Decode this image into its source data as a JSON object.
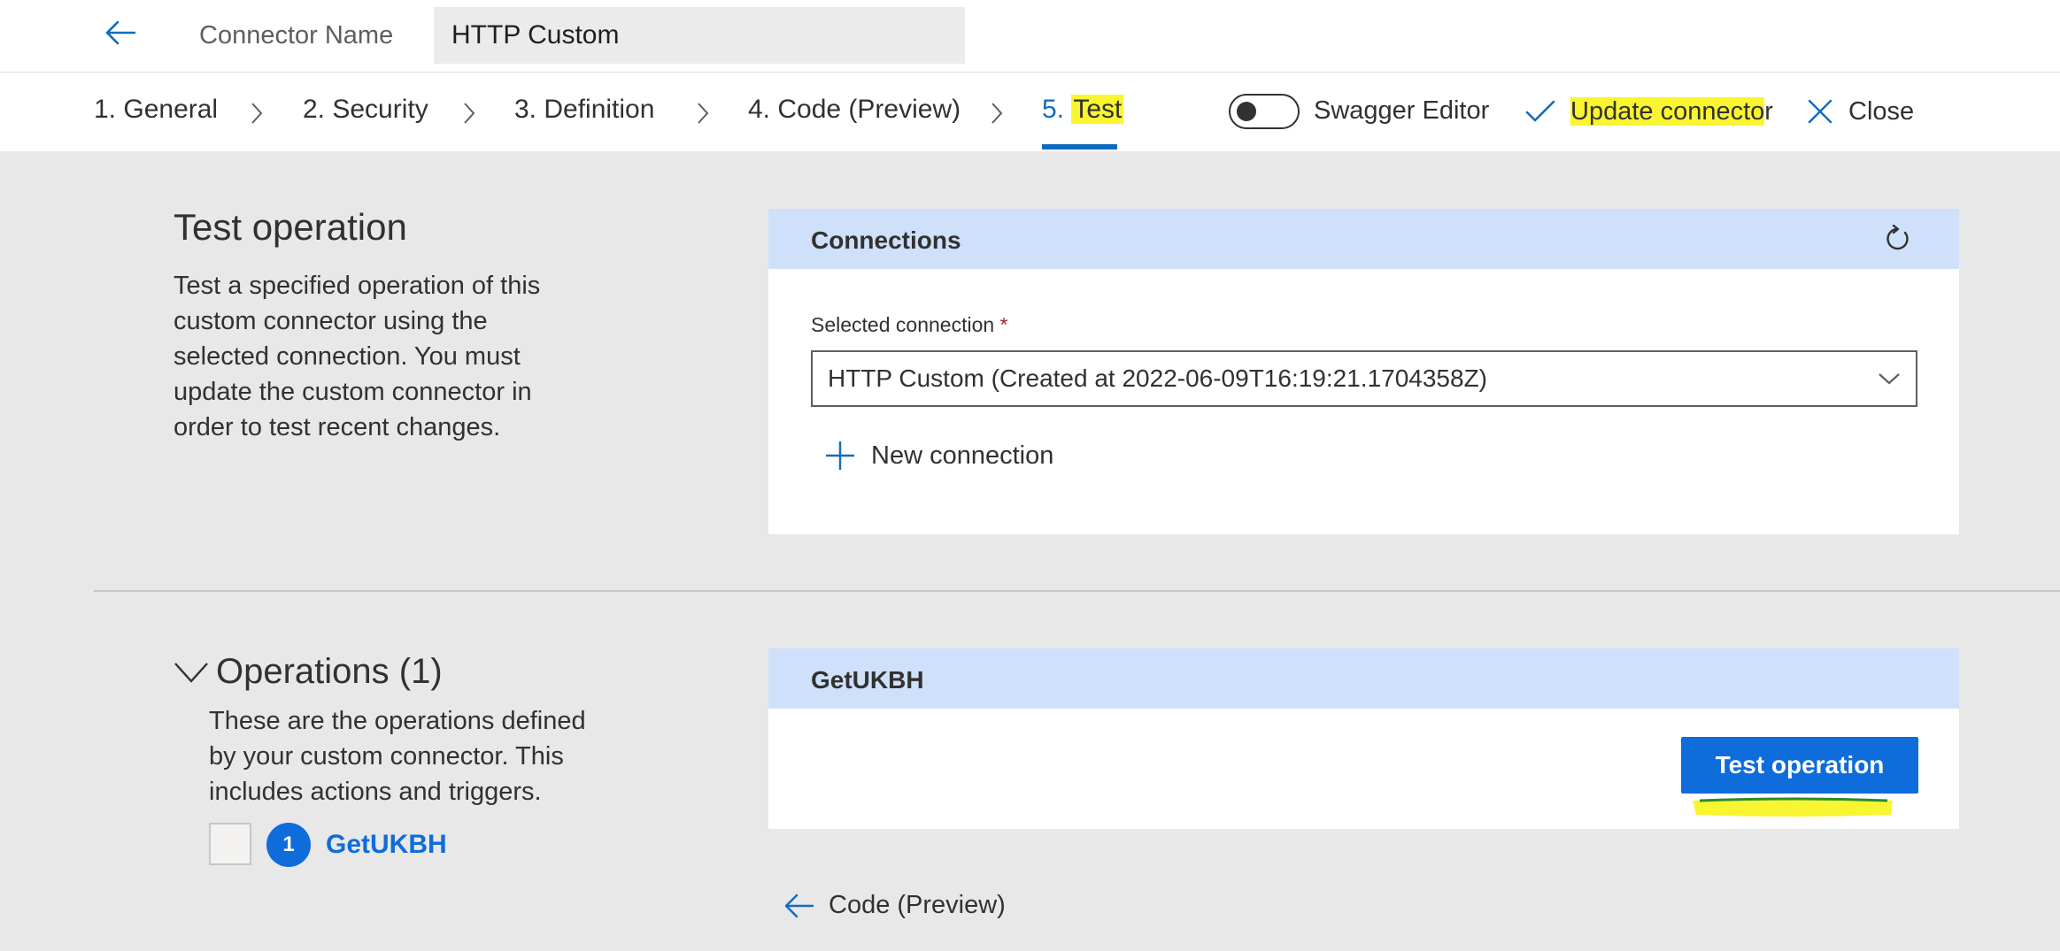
{
  "header": {
    "connector_label": "Connector Name",
    "connector_value": "HTTP Custom"
  },
  "nav": {
    "steps": [
      {
        "prefix": "1. ",
        "label": "General"
      },
      {
        "prefix": "2. ",
        "label": "Security"
      },
      {
        "prefix": "3. ",
        "label": "Definition"
      },
      {
        "prefix": "4. ",
        "label": "Code (Preview)"
      },
      {
        "prefix": "5. ",
        "label": "Test"
      }
    ],
    "active_step": "5",
    "swagger_label": "Swagger Editor",
    "swagger_on": false,
    "update_label_highlighted": "Update connecto",
    "update_label_rest": "r",
    "close_label": "Close"
  },
  "test_section": {
    "title": "Test operation",
    "description_lines": [
      "Test a specified operation of this",
      "custom connector using the",
      "selected connection. You must",
      "update the custom connector in",
      "order to test recent changes."
    ]
  },
  "connections_panel": {
    "title": "Connections",
    "selected_label": "Selected connection",
    "required_marker": "*",
    "selected_value": "HTTP Custom (Created at 2022-06-09T16:19:21.1704358Z)",
    "new_connection_label": "New connection"
  },
  "operations_section": {
    "title": "Operations (1)",
    "description_lines": [
      "These are the operations defined",
      "by your custom connector. This",
      "includes actions and triggers."
    ],
    "operations": [
      {
        "number": "1",
        "name": "GetUKBH"
      }
    ]
  },
  "operation_panel": {
    "title": "GetUKBH",
    "test_button_label": "Test operation"
  },
  "footer": {
    "back_label": "Code (Preview)"
  },
  "colors": {
    "accent": "#0f6cdb",
    "panel_header": "#cfe0fb",
    "highlight": "#f9f530",
    "background": "#e8e8e8"
  }
}
